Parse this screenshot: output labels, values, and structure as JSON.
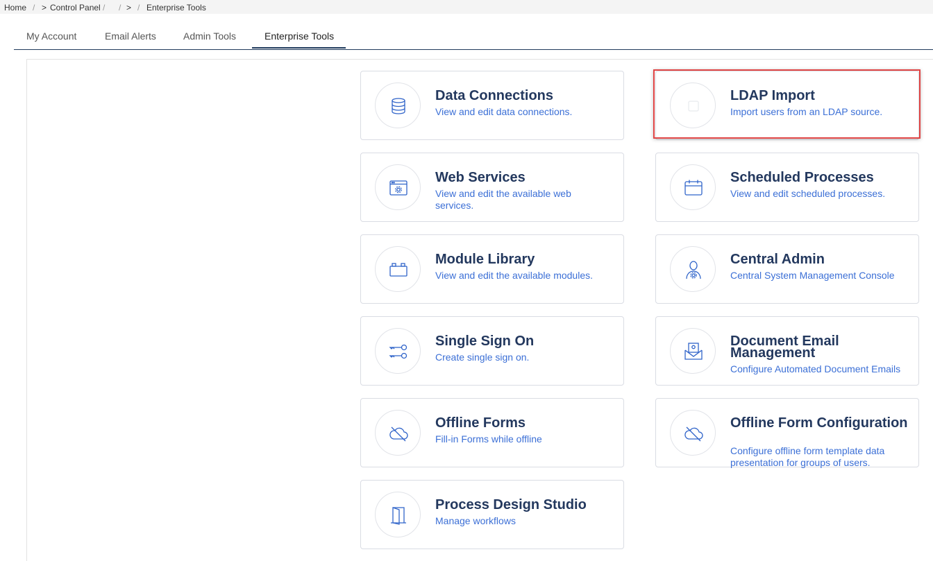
{
  "breadcrumb": {
    "home": "Home",
    "sep1": "/",
    "arrow1": ">",
    "control_panel": "Control Panel",
    "sep2": "/",
    "sep3": "/",
    "arrow2": ">",
    "sep4": "/",
    "current": "Enterprise Tools"
  },
  "tabs": [
    {
      "label": "My Account"
    },
    {
      "label": "Email Alerts"
    },
    {
      "label": "Admin Tools"
    },
    {
      "label": "Enterprise Tools",
      "active": true
    }
  ],
  "cards": [
    {
      "title": "Data Connections",
      "desc": "View and edit data connections.",
      "icon": "database-icon"
    },
    {
      "title": "LDAP Import",
      "desc": "Import users from an LDAP source.",
      "icon": "ldap-icon",
      "highlighted": true
    },
    {
      "title": "Web Services",
      "desc": "View and edit the available web services.",
      "icon": "web-services-icon"
    },
    {
      "title": "Scheduled Processes",
      "desc": "View and edit scheduled processes.",
      "icon": "calendar-icon"
    },
    {
      "title": "Module Library",
      "desc": "View and edit the available modules.",
      "icon": "module-icon"
    },
    {
      "title": "Central Admin",
      "desc": "Central System Management Console",
      "icon": "admin-user-gear-icon"
    },
    {
      "title": "Single Sign On",
      "desc": "Create single sign on.",
      "icon": "keys-icon"
    },
    {
      "title": "Document Email Management",
      "desc": "Configure Automated Document Emails",
      "icon": "document-email-icon"
    },
    {
      "title": "Offline Forms",
      "desc": "Fill-in Forms while offline",
      "icon": "cloud-off-icon"
    },
    {
      "title": "Offline Form Configuration",
      "desc": "Configure offline form template data presentation for groups of users.",
      "icon": "cloud-off-icon"
    },
    {
      "title": "Process Design Studio",
      "desc": "Manage workflows",
      "icon": "door-icon"
    }
  ],
  "colors": {
    "title": "#23385e",
    "description": "#3b6fd6",
    "icon": "#2f63c9",
    "tab_underline": "#1f3a5c",
    "highlight": "#e04444"
  }
}
